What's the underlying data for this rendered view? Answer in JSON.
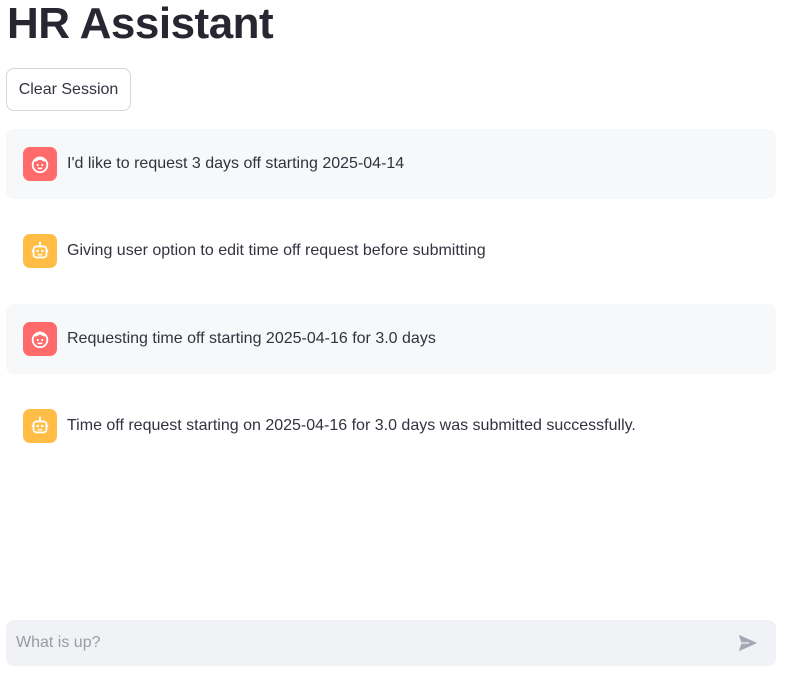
{
  "header": {
    "title": "HR Assistant"
  },
  "toolbar": {
    "clear_label": "Clear Session"
  },
  "messages": [
    {
      "role": "user",
      "avatar_icon": "user-face-icon",
      "text": "I'd like to request 3 days off starting 2025-04-14"
    },
    {
      "role": "assistant",
      "avatar_icon": "bot-icon",
      "text": "Giving user option to edit time off request before submitting"
    },
    {
      "role": "user",
      "avatar_icon": "user-face-icon",
      "text": "Requesting time off starting 2025-04-16 for 3.0 days"
    },
    {
      "role": "assistant",
      "avatar_icon": "bot-icon",
      "text": "Time off request starting on 2025-04-16 for 3.0 days was submitted successfully."
    }
  ],
  "chat_input": {
    "placeholder": "What is up?",
    "value": "",
    "send_icon": "send-icon"
  },
  "colors": {
    "user_avatar": "#ff6a6a",
    "assistant_avatar": "#ffbd45",
    "user_bubble": "#f7f8fa",
    "input_background": "#f0f2f6"
  }
}
